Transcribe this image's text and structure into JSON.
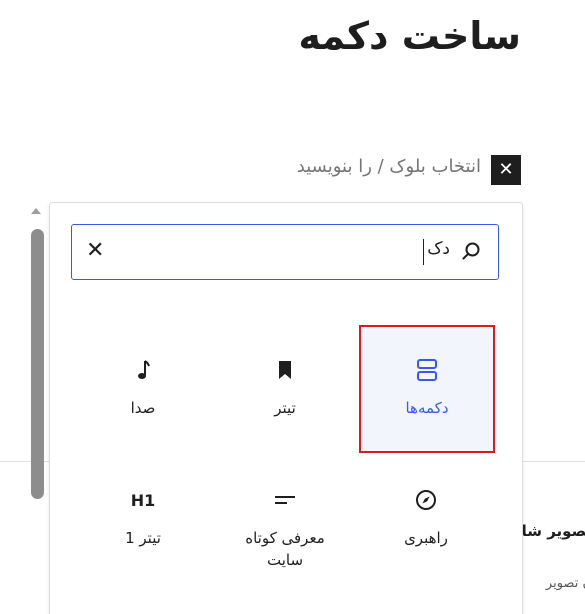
{
  "page": {
    "title": "ساخت دکمه",
    "placeholder": "انتخاب بلوک / را بنویسید",
    "close_symbol": "✕"
  },
  "search": {
    "value": "دک",
    "clear_symbol": "✕"
  },
  "blocks": [
    {
      "label": "دکمه‌ها",
      "icon": "buttons-icon",
      "selected": true
    },
    {
      "label": "تیتر",
      "icon": "bookmark-icon",
      "selected": false
    },
    {
      "label": "صدا",
      "icon": "music-note-icon",
      "selected": false
    },
    {
      "label": "راهبری",
      "icon": "compass-icon",
      "selected": false
    },
    {
      "label": "معرفی کوتاه سایت",
      "icon": "tagline-icon",
      "selected": false
    },
    {
      "label": "تیتر 1",
      "icon": "h1-icon",
      "icon_text": "H1",
      "selected": false
    }
  ],
  "background": {
    "text_1": "تصویر شا",
    "text_2": "ن تصویر"
  },
  "colors": {
    "accent": "#3858e9",
    "selection_border": "#dd1a1a",
    "dark": "#1e1e1e"
  }
}
